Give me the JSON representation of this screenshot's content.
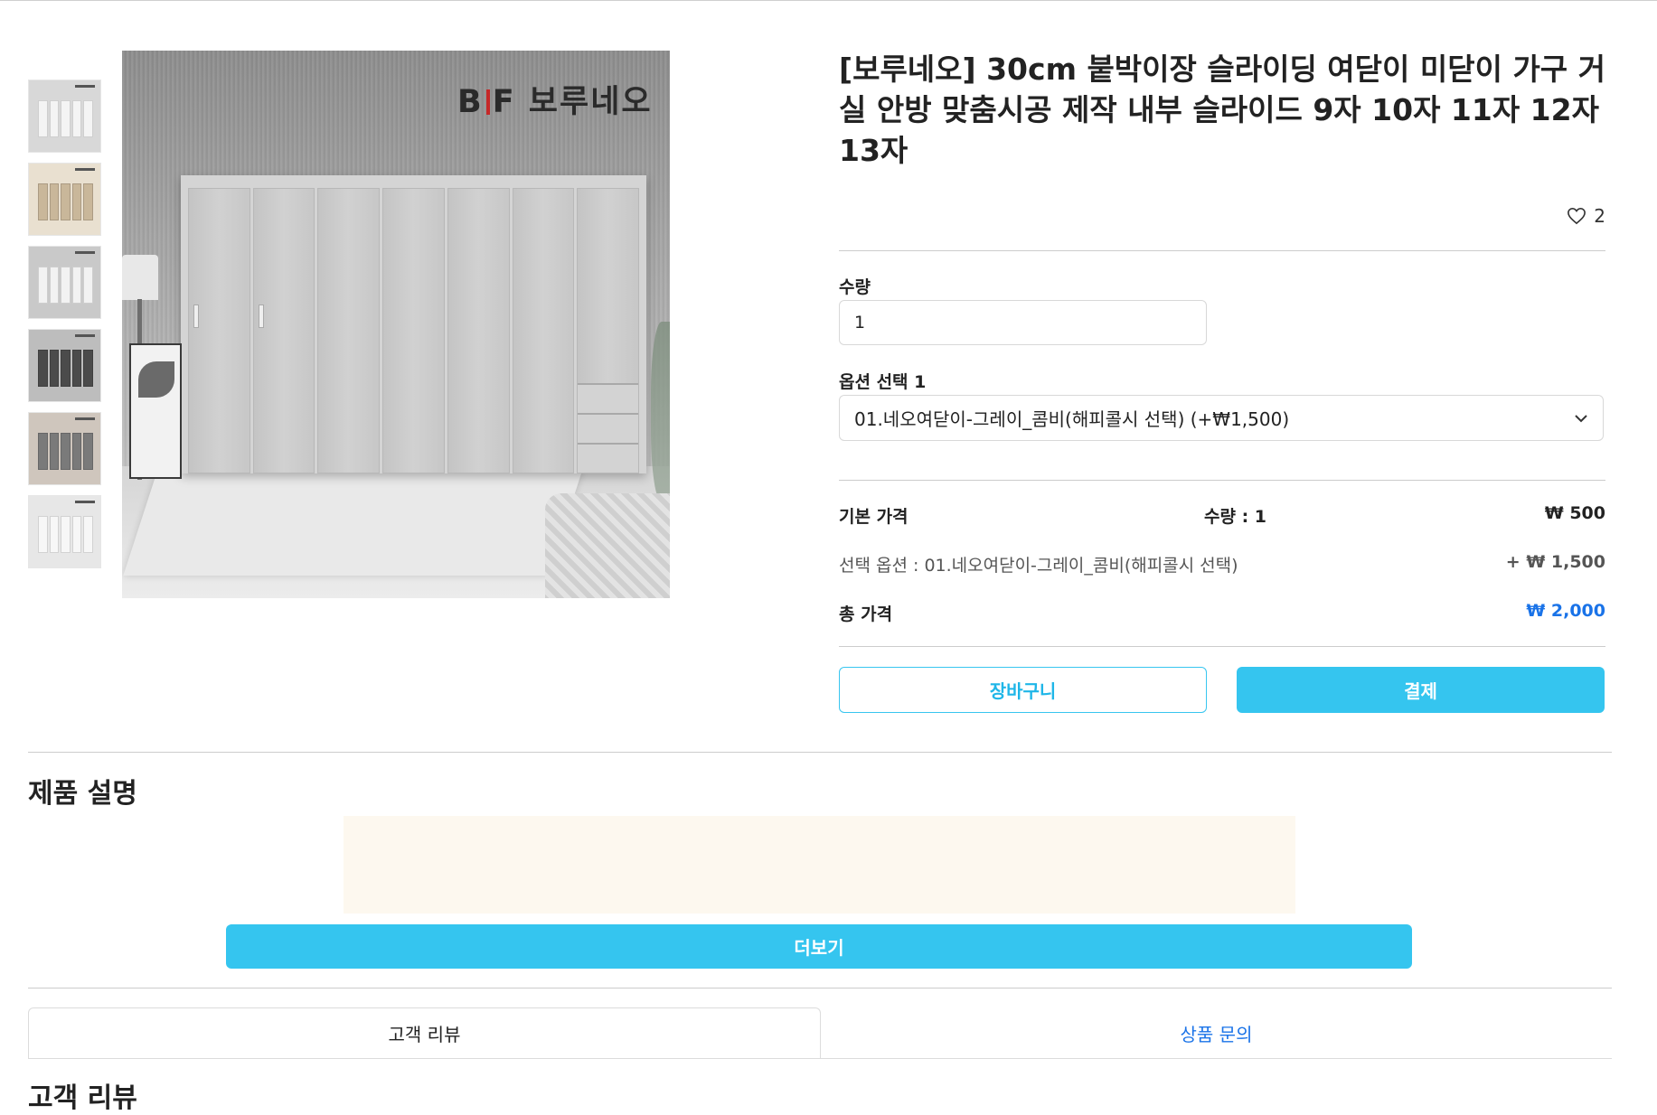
{
  "product": {
    "title": "[보루네오] 30cm 붙박이장 슬라이딩 여닫이 미닫이 가구 거실 안방 맞춤시공 제작 내부 슬라이드 9자 10자 11자 12자 13자",
    "likes": "2",
    "brand_logo_text": "B|F 보루네오",
    "brand_logo": {
      "left": "B",
      "right": "F",
      "name": "보루네오"
    }
  },
  "thumbnails": [
    {
      "name": "white-wardrobe",
      "wall": "#d8d8d8",
      "door": "#f4f4f4"
    },
    {
      "name": "open-drawers",
      "wall": "#e9e0d0",
      "door": "#c9b79a"
    },
    {
      "name": "white-wardrobe-2",
      "wall": "#c9c9c9",
      "door": "#f2f2f2"
    },
    {
      "name": "dark-wardrobe",
      "wall": "#bdbdbd",
      "door": "#4b4b4b"
    },
    {
      "name": "gray-wardrobe-room",
      "wall": "#cfc6bd",
      "door": "#7a7a7a"
    },
    {
      "name": "white-green-wardrobe",
      "wall": "#e7e7e7",
      "door": "#f7f7f7"
    }
  ],
  "quantity": {
    "label": "수량",
    "value": "1"
  },
  "option": {
    "label": "옵션 선택 1",
    "selected": "01.네오여닫이-그레이_콤비(해피콜시 선택) (+₩1,500)",
    "icon": "chevron-down-icon"
  },
  "price": {
    "base_label": "기본 가격",
    "qty_text": "수량 : 1",
    "base_value": "₩ 500",
    "option_text": "선택 옵션 : 01.네오여닫이-그레이_콤비(해피콜시 선택)",
    "option_value": "+ ₩ 1,500",
    "total_label": "총 가격",
    "total_value": "₩ 2,000"
  },
  "buttons": {
    "cart": "장바구니",
    "pay": "결제",
    "more": "더보기"
  },
  "description": {
    "title": "제품 설명"
  },
  "tabs": [
    {
      "label": "고객 리뷰",
      "active": true
    },
    {
      "label": "상품 문의",
      "active": false
    }
  ],
  "reviews": {
    "title": "고객 리뷰"
  },
  "colors": {
    "accent": "#35c5ef",
    "link_blue": "#1a73e8",
    "total_blue": "#1a73e8"
  }
}
